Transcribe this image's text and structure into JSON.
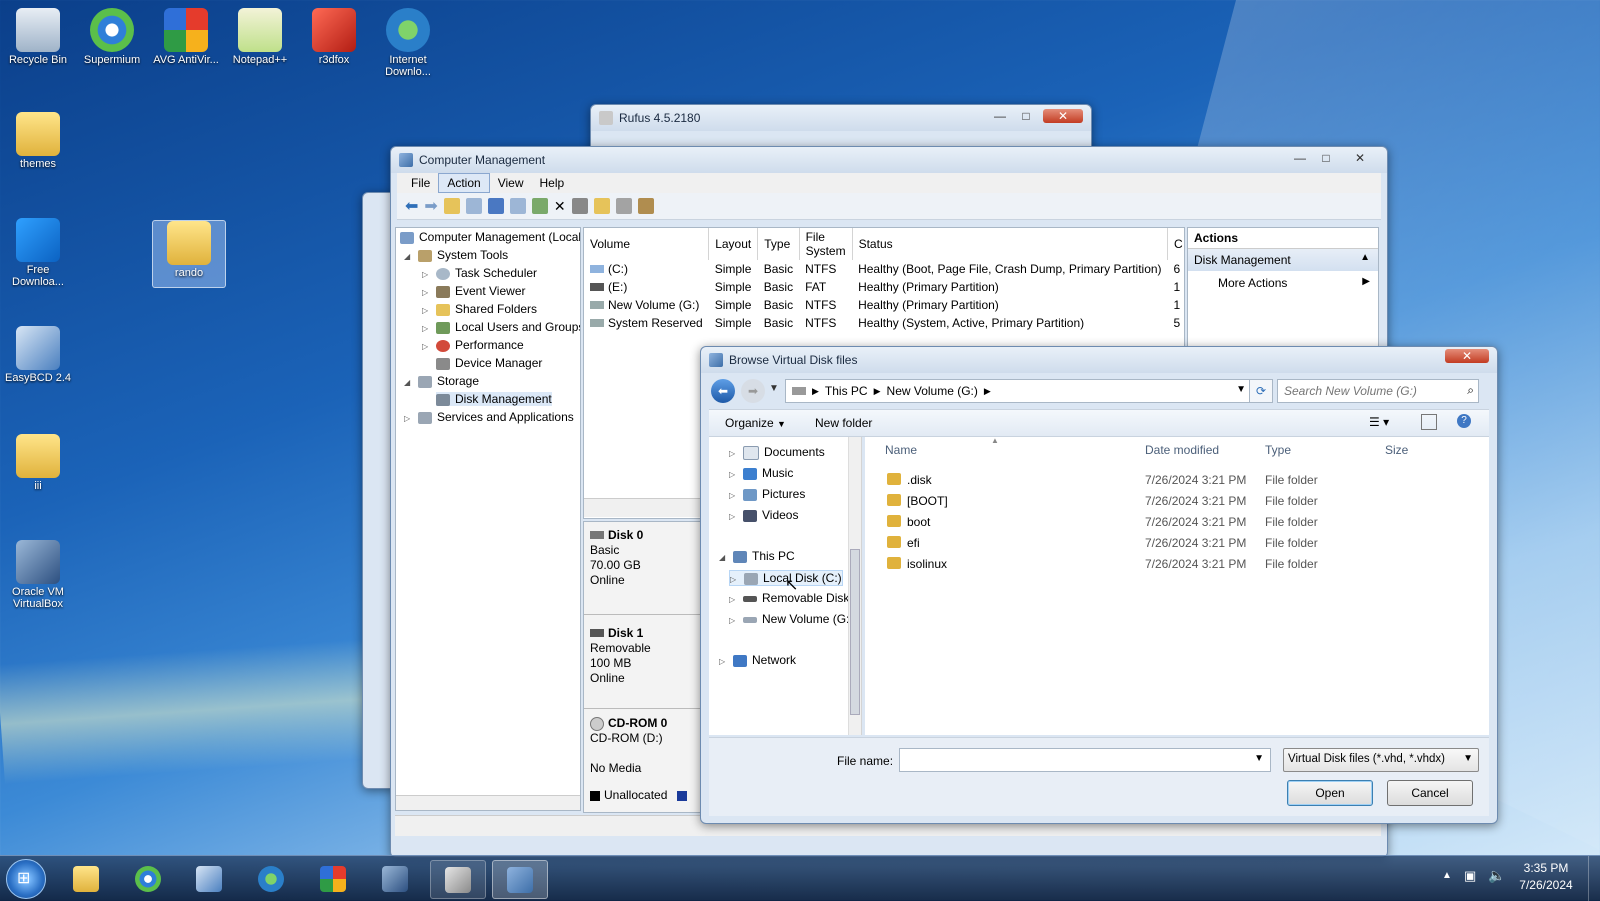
{
  "desktop": {
    "icons": [
      {
        "label": "Recycle Bin"
      },
      {
        "label": "Supermium"
      },
      {
        "label": "AVG AntiVir..."
      },
      {
        "label": "Notepad++"
      },
      {
        "label": "r3dfox"
      },
      {
        "label": "Internet Downlo..."
      },
      {
        "label": "themes"
      },
      {
        "label": "Free Downloa..."
      },
      {
        "label": "rando"
      },
      {
        "label": "EasyBCD 2.4"
      },
      {
        "label": "iii"
      },
      {
        "label": "Oracle VM VirtualBox"
      }
    ]
  },
  "rufus": {
    "title": "Rufus 4.5.2180"
  },
  "computer_management": {
    "title": "Computer Management",
    "menu": [
      "File",
      "Action",
      "View",
      "Help"
    ],
    "tree": [
      {
        "label": "Computer Management (Local"
      },
      {
        "label": "System Tools"
      },
      {
        "label": "Task Scheduler"
      },
      {
        "label": "Event Viewer"
      },
      {
        "label": "Shared Folders"
      },
      {
        "label": "Local Users and Groups"
      },
      {
        "label": "Performance"
      },
      {
        "label": "Device Manager"
      },
      {
        "label": "Storage"
      },
      {
        "label": "Disk Management"
      },
      {
        "label": "Services and Applications"
      }
    ],
    "volume_columns": [
      "Volume",
      "Layout",
      "Type",
      "File System",
      "Status",
      "C"
    ],
    "volumes": [
      {
        "volume": "(C:)",
        "layout": "Simple",
        "type": "Basic",
        "fs": "NTFS",
        "status": "Healthy (Boot, Page File, Crash Dump, Primary Partition)",
        "c": "6"
      },
      {
        "volume": "(E:)",
        "layout": "Simple",
        "type": "Basic",
        "fs": "FAT",
        "status": "Healthy (Primary Partition)",
        "c": "1"
      },
      {
        "volume": "New Volume (G:)",
        "layout": "Simple",
        "type": "Basic",
        "fs": "NTFS",
        "status": "Healthy (Primary Partition)",
        "c": "1"
      },
      {
        "volume": "System Reserved",
        "layout": "Simple",
        "type": "Basic",
        "fs": "NTFS",
        "status": "Healthy (System, Active, Primary Partition)",
        "c": "5"
      }
    ],
    "disks": [
      {
        "name": "Disk 0",
        "l1": "Basic",
        "l2": "70.00 GB",
        "l3": "Online"
      },
      {
        "name": "Disk 1",
        "l1": "Removable",
        "l2": "100 MB",
        "l3": "Online"
      },
      {
        "name": "CD-ROM 0",
        "l1": "CD-ROM (D:)",
        "l2": "",
        "l3": "No Media"
      }
    ],
    "legend_unallocated": "Unallocated",
    "actions": {
      "header": "Actions",
      "section": "Disk Management",
      "more": "More Actions"
    }
  },
  "browse_dialog": {
    "title": "Browse Virtual Disk files",
    "breadcrumb": [
      "This PC",
      "New Volume (G:)"
    ],
    "search_placeholder": "Search New Volume (G:)",
    "organize": "Organize",
    "new_folder": "New folder",
    "nav": [
      {
        "label": "Documents"
      },
      {
        "label": "Music"
      },
      {
        "label": "Pictures"
      },
      {
        "label": "Videos"
      },
      {
        "label": "This PC"
      },
      {
        "label": "Local Disk (C:)"
      },
      {
        "label": "Removable Disk ("
      },
      {
        "label": "New Volume (G:)"
      },
      {
        "label": "Network"
      }
    ],
    "columns": {
      "name": "Name",
      "date": "Date modified",
      "type": "Type",
      "size": "Size"
    },
    "files": [
      {
        "name": ".disk",
        "date": "7/26/2024 3:21 PM",
        "type": "File folder"
      },
      {
        "name": "[BOOT]",
        "date": "7/26/2024 3:21 PM",
        "type": "File folder"
      },
      {
        "name": "boot",
        "date": "7/26/2024 3:21 PM",
        "type": "File folder"
      },
      {
        "name": "efi",
        "date": "7/26/2024 3:21 PM",
        "type": "File folder"
      },
      {
        "name": "isolinux",
        "date": "7/26/2024 3:21 PM",
        "type": "File folder"
      }
    ],
    "file_name_label": "File name:",
    "file_name_value": "",
    "filter": "Virtual Disk files (*.vhd, *.vhdx)",
    "open": "Open",
    "cancel": "Cancel"
  },
  "taskbar": {
    "time": "3:35 PM",
    "date": "7/26/2024"
  }
}
